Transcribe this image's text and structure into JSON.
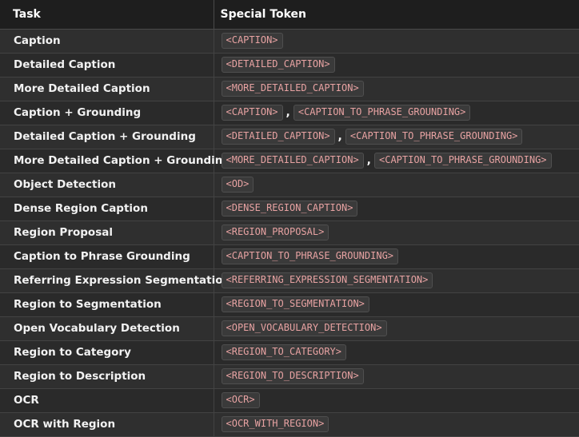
{
  "header": {
    "task_label": "Task",
    "token_label": "Special Token"
  },
  "rows": [
    {
      "task": "Caption",
      "tokens": [
        "<CAPTION>"
      ]
    },
    {
      "task": "Detailed Caption",
      "tokens": [
        "<DETAILED_CAPTION>"
      ]
    },
    {
      "task": "More Detailed Caption",
      "tokens": [
        "<MORE_DETAILED_CAPTION>"
      ]
    },
    {
      "task": "Caption + Grounding",
      "tokens": [
        "<CAPTION>",
        "<CAPTION_TO_PHRASE_GROUNDING>"
      ]
    },
    {
      "task": "Detailed Caption + Grounding",
      "tokens": [
        "<DETAILED_CAPTION>",
        "<CAPTION_TO_PHRASE_GROUNDING>"
      ]
    },
    {
      "task": "More Detailed Caption + Grounding",
      "tokens": [
        "<MORE_DETAILED_CAPTION>",
        "<CAPTION_TO_PHRASE_GROUNDING>"
      ]
    },
    {
      "task": "Object Detection",
      "tokens": [
        "<OD>"
      ]
    },
    {
      "task": "Dense Region Caption",
      "tokens": [
        "<DENSE_REGION_CAPTION>"
      ]
    },
    {
      "task": "Region Proposal",
      "tokens": [
        "<REGION_PROPOSAL>"
      ]
    },
    {
      "task": "Caption to Phrase Grounding",
      "tokens": [
        "<CAPTION_TO_PHRASE_GROUNDING>"
      ]
    },
    {
      "task": "Referring Expression Segmentation",
      "tokens": [
        "<REFERRING_EXPRESSION_SEGMENTATION>"
      ]
    },
    {
      "task": "Region to Segmentation",
      "tokens": [
        "<REGION_TO_SEGMENTATION>"
      ]
    },
    {
      "task": "Open Vocabulary Detection",
      "tokens": [
        "<OPEN_VOCABULARY_DETECTION>"
      ]
    },
    {
      "task": "Region to Category",
      "tokens": [
        "<REGION_TO_CATEGORY>"
      ]
    },
    {
      "task": "Region to Description",
      "tokens": [
        "<REGION_TO_DESCRIPTION>"
      ]
    },
    {
      "task": "OCR",
      "tokens": [
        "<OCR>"
      ]
    },
    {
      "task": "OCR with Region",
      "tokens": [
        "<OCR_WITH_REGION>"
      ]
    }
  ],
  "token_separator": ","
}
